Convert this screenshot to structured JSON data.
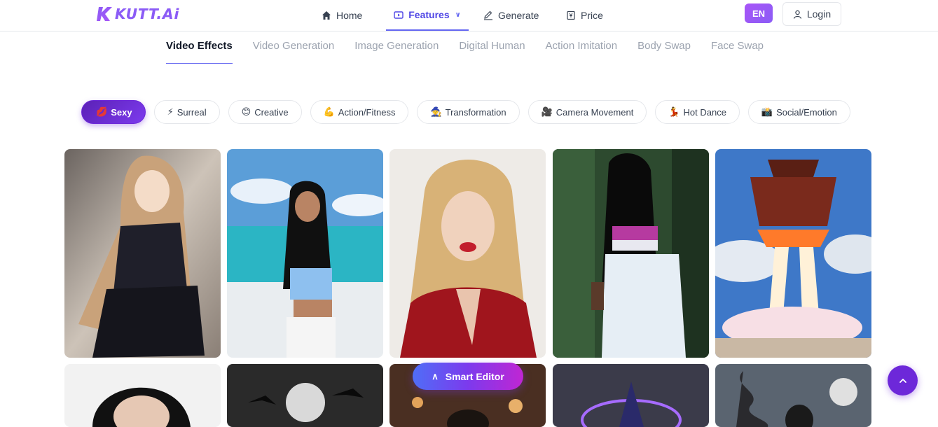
{
  "brand": {
    "name": "KUTT.Ai"
  },
  "nav": {
    "home": "Home",
    "features": "Features",
    "generate": "Generate",
    "price": "Price",
    "language": "EN",
    "login": "Login"
  },
  "subtabs": [
    {
      "label": "Video Effects",
      "active": true
    },
    {
      "label": "Video Generation",
      "active": false
    },
    {
      "label": "Image Generation",
      "active": false
    },
    {
      "label": "Digital Human",
      "active": false
    },
    {
      "label": "Action Imitation",
      "active": false
    },
    {
      "label": "Body Swap",
      "active": false
    },
    {
      "label": "Face Swap",
      "active": false
    }
  ],
  "categories": [
    {
      "emoji": "💋",
      "label": "Sexy",
      "active": true
    },
    {
      "emoji": "⚡",
      "label": "Surreal",
      "active": false
    },
    {
      "emoji": "😊",
      "label": "Creative",
      "active": false
    },
    {
      "emoji": "💪",
      "label": "Action/Fitness",
      "active": false
    },
    {
      "emoji": "🧙",
      "label": "Transformation",
      "active": false
    },
    {
      "emoji": "🎥",
      "label": "Camera Movement",
      "active": false
    },
    {
      "emoji": "💃",
      "label": "Hot Dance",
      "active": false
    },
    {
      "emoji": "📸",
      "label": "Social/Emotion",
      "active": false
    }
  ],
  "floating": {
    "smart_editor": "Smart Editor"
  },
  "colors": {
    "accent": "#7c3aed",
    "nav_active": "#4f46e5",
    "tab_underline": "#6366f1"
  }
}
